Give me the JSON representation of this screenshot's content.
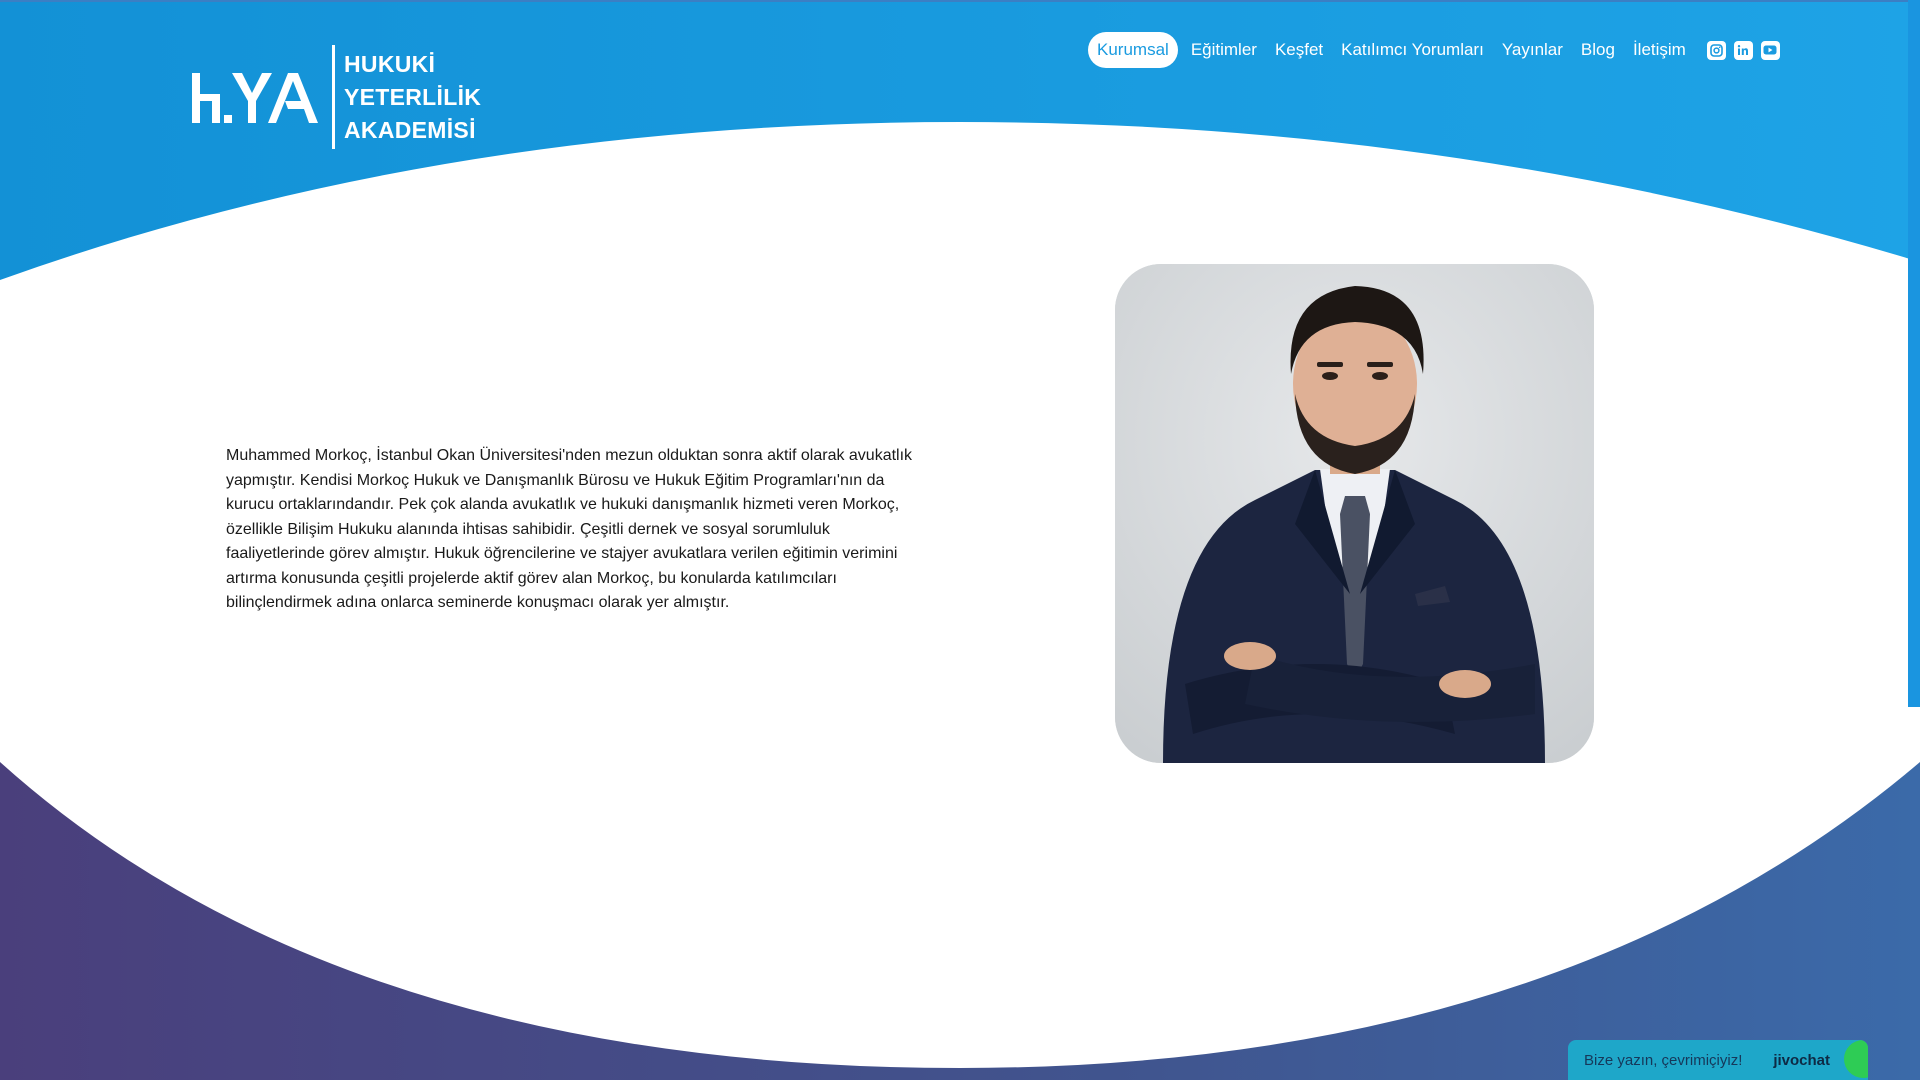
{
  "brand": {
    "logo_mark": "H.YA",
    "name_lines": [
      "HUKUKİ",
      "YETERLİLİK",
      "AKADEMİSİ"
    ]
  },
  "nav": {
    "items": [
      {
        "label": "Kurumsal",
        "active": true
      },
      {
        "label": "Eğitimler"
      },
      {
        "label": "Keşfet"
      },
      {
        "label": "Katılımcı Yorumları"
      },
      {
        "label": "Yayınlar"
      },
      {
        "label": "Blog"
      },
      {
        "label": "İletişim"
      }
    ],
    "social_icons": [
      "instagram-icon",
      "linkedin-icon",
      "youtube-icon"
    ]
  },
  "bio": {
    "text": "Muhammed Morkoç, İstanbul Okan Üniversitesi'nden mezun olduktan sonra aktif olarak avukatlık yapmıştır. Kendisi Morkoç Hukuk ve Danışmanlık Bürosu ve Hukuk Eğitim Programları'nın da kurucu ortaklarındandır. Pek çok alanda avukatlık ve hukuki danışmanlık hizmeti veren Morkoç, özellikle Bilişim Hukuku alanında ihtisas sahibidir. Çeşitli dernek ve sosyal sorumluluk faaliyetlerinde görev almıştır. Hukuk öğrencilerine ve stajyer avukatlara verilen eğitimin verimini artırma konusunda çeşitli projelerde aktif görev alan Morkoç, bu konularda katılımcıları bilinçlendirmek adına onlarca seminerde konuşmacı olarak yer almıştır."
  },
  "chat": {
    "prompt": "Bize yazın, çevrimiçiyiz!",
    "brand": "jivochat"
  },
  "colors": {
    "header_blue": "#1a9be0",
    "footer_purple": "#4a4380",
    "footer_blue": "#3a6aa8"
  }
}
